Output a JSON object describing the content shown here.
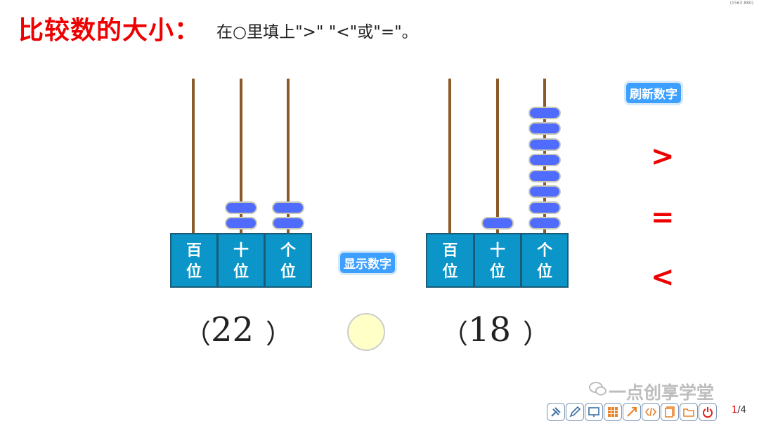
{
  "corner_coords": "(1563.880)",
  "title": "比较数的大小：",
  "instruction": "在○里填上\">\" \"<\"或\"=\"。",
  "abacus_left": {
    "number": "22",
    "places": [
      {
        "line1": "百",
        "line2": "位",
        "beads": 0
      },
      {
        "line1": "十",
        "line2": "位",
        "beads": 2
      },
      {
        "line1": "个",
        "line2": "位",
        "beads": 2
      }
    ]
  },
  "abacus_right": {
    "number": "18",
    "places": [
      {
        "line1": "百",
        "line2": "位",
        "beads": 0
      },
      {
        "line1": "十",
        "line2": "位",
        "beads": 1
      },
      {
        "line1": "个",
        "line2": "位",
        "beads": 8
      }
    ]
  },
  "buttons": {
    "show_number": "显示数字",
    "refresh_number": "刷新数字"
  },
  "paren_open": "（",
  "paren_close": "）",
  "symbols": {
    "greater": ">",
    "equal": "=",
    "less": "<"
  },
  "watermark": "一点创享学堂",
  "toolbar_icons": [
    "tools-icon",
    "pen-icon",
    "board-icon",
    "grid-icon",
    "resize-icon",
    "code-icon",
    "pages-icon",
    "folder-icon",
    "power-icon"
  ],
  "pager": {
    "current": "1",
    "total": "4",
    "sep": "/"
  },
  "colors": {
    "title": "#ee0000",
    "bead": "#4f6cff",
    "place": "#0c95c9",
    "rod": "#8a5a2b",
    "button": "#3d9fff"
  }
}
